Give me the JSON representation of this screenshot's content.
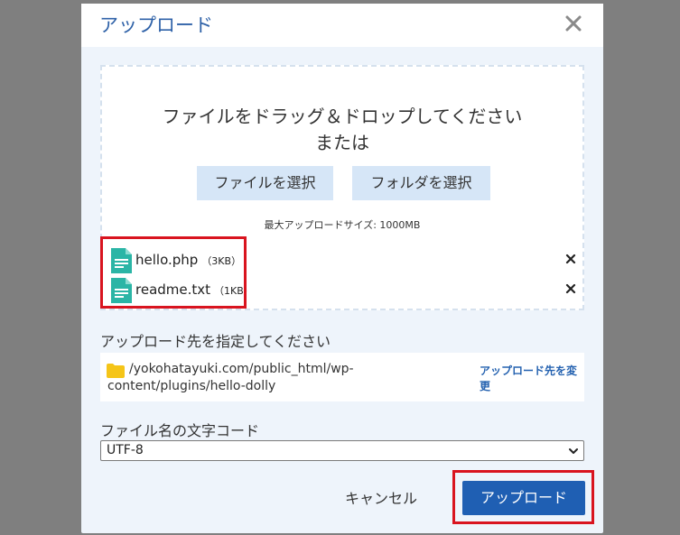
{
  "dialog": {
    "title": "アップロード"
  },
  "dropzone": {
    "line1": "ファイルをドラッグ＆ドロップしてください",
    "line2": "または",
    "select_file_label": "ファイルを選択",
    "select_folder_label": "フォルダを選択",
    "max_size_text": "最大アップロードサイズ: 1000MB",
    "files": [
      {
        "name": "hello.php",
        "size": "（3KB）"
      },
      {
        "name": "readme.txt",
        "size": "（1KB）"
      }
    ]
  },
  "destination": {
    "label": "アップロード先を指定してください",
    "path": "/yokohatayuki.com/public_html/wp-content/plugins/hello-dolly",
    "change_label": "アップロード先を変更"
  },
  "encoding": {
    "label": "ファイル名の文字コード",
    "selected": "UTF-8"
  },
  "footer": {
    "cancel_label": "キャンセル",
    "upload_label": "アップロード"
  },
  "colors": {
    "accent": "#1f5fb3",
    "highlight": "#d9141f",
    "file_icon": "#2bb5a6",
    "folder_icon": "#f5c518"
  }
}
